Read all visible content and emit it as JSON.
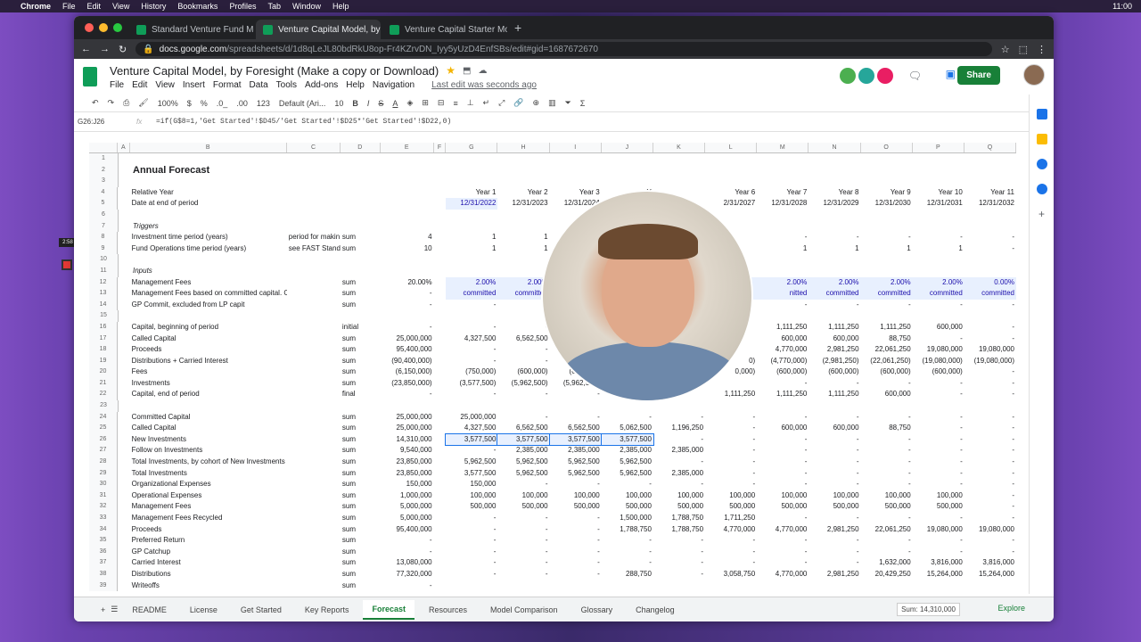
{
  "menubar": {
    "apple": "",
    "app": "Chrome",
    "items": [
      "File",
      "Edit",
      "View",
      "History",
      "Bookmarks",
      "Profiles",
      "Tab",
      "Window",
      "Help"
    ],
    "clock": "11:00"
  },
  "browser": {
    "tabs": [
      {
        "label": "Standard Venture Fund Model,"
      },
      {
        "label": "Venture Capital Model, by For..."
      },
      {
        "label": "Venture Capital Starter Model,"
      }
    ],
    "url_host": "docs.google.com",
    "url_path": "/spreadsheets/d/1d8qLeJL80bdRkU8op-Fr4KZrvDN_Iyy5yUzD4EnfSBs/edit#gid=1687672670"
  },
  "doc": {
    "title": "Venture Capital Model, by Foresight (Make a copy or Download)",
    "menu": [
      "File",
      "Edit",
      "View",
      "Insert",
      "Format",
      "Data",
      "Tools",
      "Add-ons",
      "Help",
      "Navigation"
    ],
    "last_edit": "Last edit was seconds ago",
    "share": "Share"
  },
  "toolbar": {
    "zoom": "100%",
    "currency": "$",
    "percent": "%",
    "dec0": ".0_",
    "dec00": ".00",
    "fmt": "123",
    "font": "Default (Ari...",
    "size": "10"
  },
  "formula_bar": {
    "cell": "G26:J26",
    "fx": "fx",
    "formula": "=if(G$8=1,'Get Started'!$D45/'Get Started'!$D25*'Get Started'!$D22,0)"
  },
  "recorder": {
    "time": "2:58"
  },
  "columns": [
    "",
    "A",
    "B",
    "C",
    "D",
    "E",
    "F",
    "G",
    "H",
    "I",
    "J",
    "K",
    "L",
    "M",
    "N",
    "O",
    "P",
    "Q"
  ],
  "rows": [
    [
      "1",
      "",
      "",
      "",
      "",
      "",
      "",
      "",
      "",
      "",
      "",
      "",
      "",
      "",
      "",
      "",
      ""
    ],
    [
      "2",
      "",
      "Annual Forecast",
      "",
      "",
      "",
      "",
      "",
      "",
      "",
      "",
      "",
      "",
      "",
      "",
      "",
      ""
    ],
    [
      "3",
      "",
      "",
      "",
      "",
      "",
      "",
      "",
      "",
      "",
      "",
      "",
      "",
      "",
      "",
      "",
      ""
    ],
    [
      "4",
      "",
      "Relative Year",
      "",
      "",
      "",
      "",
      "Year 1",
      "Year 2",
      "Year 3",
      "Y",
      "",
      "Year 6",
      "Year 7",
      "Year 8",
      "Year 9",
      "Year 10",
      "Year 11"
    ],
    [
      "5",
      "",
      "Date at end of period",
      "",
      "",
      "",
      "",
      "12/31/2022",
      "12/31/2023",
      "12/31/2024",
      "",
      "",
      "2/31/2027",
      "12/31/2028",
      "12/31/2029",
      "12/31/2030",
      "12/31/2031",
      "12/31/2032"
    ],
    [
      "6",
      "",
      "",
      "",
      "",
      "",
      "",
      "",
      "",
      "",
      "",
      "",
      "",
      "",
      "",
      "",
      ""
    ],
    [
      "7",
      "",
      "Triggers",
      "",
      "",
      "",
      "",
      "",
      "",
      "",
      "",
      "",
      "",
      "",
      "",
      "",
      ""
    ],
    [
      "8",
      "",
      "Investment time period (years)",
      "period for makin",
      "sum",
      "4",
      "",
      "1",
      "1",
      "",
      "",
      "",
      "",
      "-",
      "-",
      "-",
      "-",
      "-"
    ],
    [
      "9",
      "",
      "Fund Operations time period (years)",
      "see FAST Stand",
      "sum",
      "10",
      "",
      "1",
      "1",
      "",
      "",
      "",
      "",
      "1",
      "1",
      "1",
      "1",
      "-"
    ],
    [
      "10",
      "",
      "",
      "",
      "",
      "",
      "",
      "",
      "",
      "",
      "",
      "",
      "",
      "",
      "",
      "",
      ""
    ],
    [
      "11",
      "",
      "Inputs",
      "",
      "",
      "",
      "",
      "",
      "",
      "",
      "",
      "",
      "",
      "",
      "",
      "",
      ""
    ],
    [
      "12",
      "",
      "Management Fees",
      "",
      "sum",
      "20.00%",
      "",
      "2.00%",
      "2.00%",
      "",
      "",
      "",
      "",
      "2.00%",
      "2.00%",
      "2.00%",
      "2.00%",
      "0.00%"
    ],
    [
      "13",
      "",
      "Management Fees based on committed capital. Can",
      "",
      "sum",
      "-",
      "",
      "committed",
      "committed",
      "co",
      "",
      "",
      "",
      "nitted",
      "committed",
      "committed",
      "committed",
      "committed"
    ],
    [
      "14",
      "",
      "GP Commit, excluded from LP capit",
      "",
      "sum",
      "-",
      "",
      "-",
      "-",
      "",
      "",
      "",
      "",
      "-",
      "-",
      "-",
      "-",
      "-"
    ],
    [
      "15",
      "",
      "",
      "",
      "",
      "",
      "",
      "",
      "",
      "",
      "",
      "",
      "",
      "",
      "",
      "",
      ""
    ],
    [
      "16",
      "",
      "Capital, beginning of period",
      "",
      "initial",
      "-",
      "",
      "-",
      "-",
      "",
      "",
      "",
      "",
      "1,111,250",
      "1,111,250",
      "1,111,250",
      "600,000",
      "-"
    ],
    [
      "17",
      "",
      "Called Capital",
      "",
      "sum",
      "25,000,000",
      "",
      "4,327,500",
      "6,562,500",
      "6,5",
      "",
      "",
      "",
      "600,000",
      "600,000",
      "88,750",
      "-",
      "-"
    ],
    [
      "18",
      "",
      "Proceeds",
      "",
      "sum",
      "95,400,000",
      "",
      "-",
      "-",
      "",
      "",
      "",
      "",
      "4,770,000",
      "2,981,250",
      "22,061,250",
      "19,080,000",
      "19,080,000"
    ],
    [
      "19",
      "",
      "Distributions + Carried Interest",
      "",
      "sum",
      "(90,400,000)",
      "",
      "-",
      "-",
      "",
      "",
      "",
      "0)",
      "(4,770,000)",
      "(2,981,250)",
      "(22,061,250)",
      "(19,080,000)",
      "(19,080,000)"
    ],
    [
      "20",
      "",
      "Fees",
      "",
      "sum",
      "(6,150,000)",
      "",
      "(750,000)",
      "(600,000)",
      "(600,000)",
      "",
      "",
      "0,000)",
      "(600,000)",
      "(600,000)",
      "(600,000)",
      "(600,000)",
      "-"
    ],
    [
      "21",
      "",
      "Investments",
      "",
      "sum",
      "(23,850,000)",
      "",
      "(3,577,500)",
      "(5,962,500)",
      "(5,962,500)",
      "",
      "",
      "",
      "-",
      "-",
      "-",
      "-",
      "-"
    ],
    [
      "22",
      "",
      "Capital, end of period",
      "",
      "final",
      "-",
      "",
      "-",
      "-",
      "-",
      "",
      "",
      "1,111,250",
      "1,111,250",
      "1,111,250",
      "600,000",
      "-",
      "-"
    ],
    [
      "23",
      "",
      "",
      "",
      "",
      "",
      "",
      "",
      "",
      "",
      "",
      "",
      "",
      "",
      "",
      "",
      ""
    ],
    [
      "24",
      "",
      "Committed Capital",
      "",
      "sum",
      "25,000,000",
      "",
      "25,000,000",
      "-",
      "-",
      "-",
      "-",
      "-",
      "-",
      "-",
      "-",
      "-",
      "-"
    ],
    [
      "25",
      "",
      "Called Capital",
      "",
      "sum",
      "25,000,000",
      "",
      "4,327,500",
      "6,562,500",
      "6,562,500",
      "5,062,500",
      "1,196,250",
      "-",
      "600,000",
      "600,000",
      "88,750",
      "-",
      "-"
    ],
    [
      "26",
      "",
      "New Investments",
      "",
      "sum",
      "14,310,000",
      "",
      "3,577,500",
      "3,577,500",
      "3,577,500",
      "3,577,500",
      "-",
      "-",
      "-",
      "-",
      "-",
      "-",
      "-"
    ],
    [
      "27",
      "",
      "Follow on Investments",
      "",
      "sum",
      "9,540,000",
      "",
      "-",
      "2,385,000",
      "2,385,000",
      "2,385,000",
      "2,385,000",
      "-",
      "-",
      "-",
      "-",
      "-",
      "-"
    ],
    [
      "28",
      "",
      "Total Investments, by cohort of New Investments",
      "",
      "sum",
      "23,850,000",
      "",
      "5,962,500",
      "5,962,500",
      "5,962,500",
      "5,962,500",
      "-",
      "-",
      "-",
      "-",
      "-",
      "-",
      "-"
    ],
    [
      "29",
      "",
      "Total Investments",
      "",
      "sum",
      "23,850,000",
      "",
      "3,577,500",
      "5,962,500",
      "5,962,500",
      "5,962,500",
      "2,385,000",
      "-",
      "-",
      "-",
      "-",
      "-",
      "-"
    ],
    [
      "30",
      "",
      "Organizational Expenses",
      "",
      "sum",
      "150,000",
      "",
      "150,000",
      "-",
      "-",
      "-",
      "-",
      "-",
      "-",
      "-",
      "-",
      "-",
      "-"
    ],
    [
      "31",
      "",
      "Operational Expenses",
      "",
      "sum",
      "1,000,000",
      "",
      "100,000",
      "100,000",
      "100,000",
      "100,000",
      "100,000",
      "100,000",
      "100,000",
      "100,000",
      "100,000",
      "100,000",
      "-"
    ],
    [
      "32",
      "",
      "Management Fees",
      "",
      "sum",
      "5,000,000",
      "",
      "500,000",
      "500,000",
      "500,000",
      "500,000",
      "500,000",
      "500,000",
      "500,000",
      "500,000",
      "500,000",
      "500,000",
      "-"
    ],
    [
      "33",
      "",
      "Management Fees Recycled",
      "",
      "sum",
      "5,000,000",
      "",
      "-",
      "-",
      "-",
      "1,500,000",
      "1,788,750",
      "1,711,250",
      "-",
      "-",
      "-",
      "-",
      "-"
    ],
    [
      "34",
      "",
      "Proceeds",
      "",
      "sum",
      "95,400,000",
      "",
      "-",
      "-",
      "-",
      "1,788,750",
      "1,788,750",
      "4,770,000",
      "4,770,000",
      "2,981,250",
      "22,061,250",
      "19,080,000",
      "19,080,000"
    ],
    [
      "35",
      "",
      "Preferred Return",
      "",
      "sum",
      "-",
      "",
      "-",
      "-",
      "-",
      "-",
      "-",
      "-",
      "-",
      "-",
      "-",
      "-",
      "-"
    ],
    [
      "36",
      "",
      "GP Catchup",
      "",
      "sum",
      "-",
      "",
      "-",
      "-",
      "-",
      "-",
      "-",
      "-",
      "-",
      "-",
      "-",
      "-",
      "-"
    ],
    [
      "37",
      "",
      "Carried Interest",
      "",
      "sum",
      "13,080,000",
      "",
      "-",
      "-",
      "-",
      "-",
      "-",
      "-",
      "-",
      "-",
      "1,632,000",
      "3,816,000",
      "3,816,000"
    ],
    [
      "38",
      "",
      "Distributions",
      "",
      "sum",
      "77,320,000",
      "",
      "-",
      "-",
      "-",
      "288,750",
      "-",
      "3,058,750",
      "4,770,000",
      "2,981,250",
      "20,429,250",
      "15,264,000",
      "15,264,000"
    ],
    [
      "39",
      "",
      "Writeoffs",
      "",
      "sum",
      "-",
      "",
      "",
      "",
      "",
      "",
      "",
      "",
      "",
      "",
      "",
      "",
      ""
    ]
  ],
  "sheet_tabs": [
    "README",
    "License",
    "Get Started",
    "Key Reports",
    "Forecast",
    "Resources",
    "Model Comparison",
    "Glossary",
    "Changelog"
  ],
  "active_tab": "Forecast",
  "status": {
    "sum": "Sum: 14,310,000",
    "explore": "Explore"
  },
  "colors": {
    "accent": "#188038",
    "selection": "#1a73e8",
    "input_blue": "#1a0dab"
  }
}
